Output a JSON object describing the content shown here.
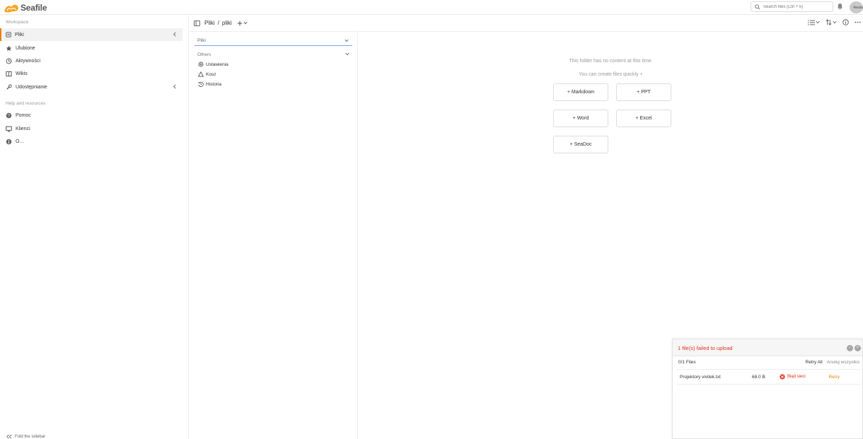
{
  "app": {
    "logo_text": "Seafile"
  },
  "header": {
    "search_placeholder": "Search files (Ctrl + k)",
    "avatar_text": "Awata"
  },
  "sidebar": {
    "workspace_label": "Workspace",
    "items": [
      {
        "label": "Pliki",
        "icon": "files-icon",
        "active": true
      },
      {
        "label": "Ulubione",
        "icon": "star-icon"
      },
      {
        "label": "Aktywności",
        "icon": "activity-icon"
      },
      {
        "label": "Wikis",
        "icon": "wiki-icon"
      },
      {
        "label": "Udostępnianie",
        "icon": "share-icon"
      }
    ],
    "help_label": "Help and resources",
    "help_items": [
      {
        "label": "Pomoc",
        "icon": "help-icon"
      },
      {
        "label": "Klienci",
        "icon": "monitor-icon"
      },
      {
        "label": "O...",
        "icon": "info-icon"
      }
    ],
    "bottom_hint": "Fold the sidebar"
  },
  "breadcrumb": {
    "root": "Pliki",
    "separator": "/",
    "current": "pliki"
  },
  "tree": {
    "selector_value": "Pliki",
    "others_label": "Others",
    "items": [
      {
        "label": "Ustawienia",
        "icon": "gear-icon"
      },
      {
        "label": "Kosz",
        "icon": "trash-icon"
      },
      {
        "label": "Historia",
        "icon": "history-icon"
      }
    ]
  },
  "content": {
    "empty_message": "This folder has no content at this time.",
    "create_hint": "You can create files quickly +",
    "buttons": {
      "markdown": "+ Markdown",
      "ppt": "+ PPT",
      "word": "+ Word",
      "excel": "+ Excel",
      "seadoc": "+ SeaDoc"
    }
  },
  "upload": {
    "title": "1 file(s) failed to upload",
    "summary": "0/1 Files",
    "retry_all": "Retry All",
    "cancel_all": "Anuluj wszystko",
    "file": {
      "name": "Projektory vivitek.txt",
      "size": "68.0 B",
      "status": "Błąd sieci",
      "retry": "Retry"
    }
  },
  "colors": {
    "accent": "#ec8000",
    "error": "#e0301e",
    "focus": "#7aa7e6"
  }
}
